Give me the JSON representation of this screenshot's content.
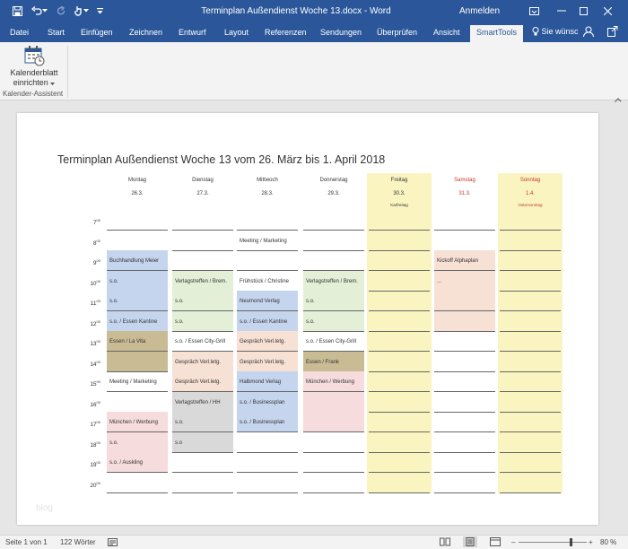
{
  "titlebar": {
    "title": "Terminplan Außendienst Woche 13.docx  -  Word",
    "signin": "Anmelden",
    "color": "#2b579a"
  },
  "tabs": [
    "Datei",
    "Start",
    "Einfügen",
    "Zeichnen",
    "Entwurf",
    "Layout",
    "Referenzen",
    "Sendungen",
    "Überprüfen",
    "Ansicht",
    "SmartTools"
  ],
  "active_tab": "SmartTools",
  "tellme": "Sie wünsc",
  "ribbon": {
    "button_line1": "Kalenderblatt",
    "button_line2": "einrichten",
    "group": "Kalender-Assistent"
  },
  "document": {
    "title": "Terminplan Außendienst Woche 13 vom 26. März bis 1. April 2018",
    "watermark": "blog",
    "days": [
      {
        "name": "Montag",
        "date": "26.3.",
        "note": "",
        "color": "#333333",
        "bg": ""
      },
      {
        "name": "Dienstag",
        "date": "27.3.",
        "note": "",
        "color": "#333333",
        "bg": ""
      },
      {
        "name": "Mittwoch",
        "date": "28.3.",
        "note": "",
        "color": "#333333",
        "bg": ""
      },
      {
        "name": "Donnerstag",
        "date": "29.3.",
        "note": "",
        "color": "#333333",
        "bg": ""
      },
      {
        "name": "Freitag",
        "date": "30.3.",
        "note": "Karfreitag",
        "color": "#333333",
        "bg": "#faf5c0"
      },
      {
        "name": "Samstag",
        "date": "31.3.",
        "note": "",
        "color": "#c0392b",
        "bg": ""
      },
      {
        "name": "Sonntag",
        "date": "1.4.",
        "note": "Ostersonntag",
        "color": "#c0392b",
        "bg": "#faf5c0"
      }
    ],
    "hours": [
      "7",
      "8",
      "9",
      "10",
      "11",
      "12",
      "13",
      "14",
      "15",
      "16",
      "17",
      "18",
      "19",
      "20"
    ],
    "appointments": [
      {
        "day": 0,
        "hour": 2,
        "text": "Buchhandlung Meier",
        "bg": "#c5d5ee"
      },
      {
        "day": 0,
        "hour": 3,
        "text": "s.o.",
        "bg": "#c5d5ee"
      },
      {
        "day": 0,
        "hour": 4,
        "text": "s.o.",
        "bg": "#c5d5ee"
      },
      {
        "day": 0,
        "hour": 5,
        "text": "s.o. / Essen Kantine",
        "bg": "#c5d5ee"
      },
      {
        "day": 0,
        "hour": 6,
        "text": "Essen / La Vita",
        "bg": "#c9bb94"
      },
      {
        "day": 0,
        "hour": 7,
        "text": "",
        "bg": "#c9bb94"
      },
      {
        "day": 0,
        "hour": 8,
        "text": "Meeting / Marketing",
        "bg": ""
      },
      {
        "day": 0,
        "hour": 10,
        "text": "München / Werbung",
        "bg": "#f6dcdc"
      },
      {
        "day": 0,
        "hour": 11,
        "text": "s.o.",
        "bg": "#f6dcdc"
      },
      {
        "day": 0,
        "hour": 12,
        "text": "s.o. / Auskling",
        "bg": "#f6dcdc"
      },
      {
        "day": 1,
        "hour": 3,
        "text": "Verlagstreffen / Brem.",
        "bg": "#e3efd7"
      },
      {
        "day": 1,
        "hour": 4,
        "text": "s.o.",
        "bg": "#e3efd7"
      },
      {
        "day": 1,
        "hour": 5,
        "text": "s.o.",
        "bg": "#e3efd7"
      },
      {
        "day": 1,
        "hour": 6,
        "text": "s.o. / Essen City-Grill",
        "bg": ""
      },
      {
        "day": 1,
        "hour": 7,
        "text": "Gespräch Verl.letg.",
        "bg": "#f7e0d4"
      },
      {
        "day": 1,
        "hour": 8,
        "text": "Gespräch Verl.letg.",
        "bg": "#f7e0d4"
      },
      {
        "day": 1,
        "hour": 9,
        "text": "Verlagstreffen / HH",
        "bg": "#d9d9d9"
      },
      {
        "day": 1,
        "hour": 10,
        "text": "s.o.",
        "bg": "#d9d9d9"
      },
      {
        "day": 1,
        "hour": 11,
        "text": "s.o",
        "bg": "#d9d9d9"
      },
      {
        "day": 2,
        "hour": 1,
        "text": "Meeting / Marketing",
        "bg": ""
      },
      {
        "day": 2,
        "hour": 3,
        "text": "Frühstück / Christine",
        "bg": ""
      },
      {
        "day": 2,
        "hour": 4,
        "text": "Neumond Verlag",
        "bg": "#c5d5ee"
      },
      {
        "day": 2,
        "hour": 5,
        "text": "s.o. / Essen Kantine",
        "bg": "#c5d5ee"
      },
      {
        "day": 2,
        "hour": 6,
        "text": "Gespräch Verl.letg.",
        "bg": "#f7e0d4"
      },
      {
        "day": 2,
        "hour": 7,
        "text": "Gespräch Verl.letg.",
        "bg": "#f7e0d4"
      },
      {
        "day": 2,
        "hour": 8,
        "text": "Halbmond Verlag",
        "bg": "#c5d5ee"
      },
      {
        "day": 2,
        "hour": 9,
        "text": "s.o. / Businessplan",
        "bg": "#c5d5ee"
      },
      {
        "day": 2,
        "hour": 10,
        "text": "s.o. / Businessplan",
        "bg": "#c5d5ee"
      },
      {
        "day": 3,
        "hour": 3,
        "text": "Verlagstreffen / Brem.",
        "bg": "#e3efd7"
      },
      {
        "day": 3,
        "hour": 4,
        "text": "s.o.",
        "bg": "#e3efd7"
      },
      {
        "day": 3,
        "hour": 5,
        "text": "s.o.",
        "bg": "#e3efd7"
      },
      {
        "day": 3,
        "hour": 6,
        "text": "s.o. / Essen City-Grill",
        "bg": ""
      },
      {
        "day": 3,
        "hour": 7,
        "text": "Essen / Frank",
        "bg": "#c9bb94"
      },
      {
        "day": 3,
        "hour": 8,
        "text": "München / Werbung",
        "bg": "#f6dcdc"
      },
      {
        "day": 3,
        "hour": 9,
        "text": "",
        "bg": "#f6dcdc"
      },
      {
        "day": 3,
        "hour": 10,
        "text": "",
        "bg": "#f6dcdc"
      },
      {
        "day": 5,
        "hour": 2,
        "text": "Kickoff Alphaplan",
        "bg": "#f7e0d4"
      },
      {
        "day": 5,
        "hour": 3,
        "text": "...",
        "bg": "#f7e0d4"
      },
      {
        "day": 5,
        "hour": 4,
        "text": "",
        "bg": "#f7e0d4"
      },
      {
        "day": 5,
        "hour": 5,
        "text": "",
        "bg": "#f7e0d4"
      }
    ]
  },
  "status": {
    "page": "Seite 1 von 1",
    "words": "122 Wörter",
    "zoom": "80 %",
    "zoom_fraction": 0.8
  }
}
